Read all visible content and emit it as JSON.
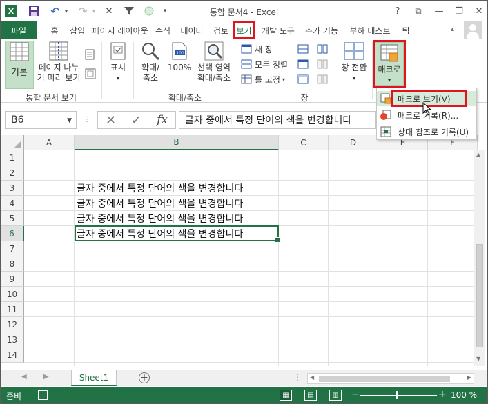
{
  "window": {
    "title": "통합 문서4 - Excel",
    "help": "?",
    "ribbon_opts": "⧉",
    "minimize": "—",
    "restore": "❐",
    "close": "✕"
  },
  "qat": {
    "app_icon": "X",
    "save": "💾",
    "undo": "↶",
    "redo": "↷",
    "more": "✕",
    "filter": "▼"
  },
  "tabs": {
    "file": "파일",
    "items": [
      "홈",
      "삽입",
      "페이지 레이아웃",
      "수식",
      "데이터",
      "검토",
      "보기",
      "개발 도구",
      "추가 기능",
      "부하 테스트",
      "팀"
    ],
    "active": "보기"
  },
  "ribbon": {
    "groups": {
      "workbook_views": "통합 문서 보기",
      "zoom": "확대/축소",
      "window": "창"
    },
    "buttons": {
      "basic": "기본",
      "page_break_l1": "페이지 나누",
      "page_break_l2": "기 미리 보기",
      "show": "표시",
      "zoom_l1": "확대/",
      "zoom_l2": "축소",
      "zoom100": "100%",
      "zoom_sel_l1": "선택 영역",
      "zoom_sel_l2": "확대/축소",
      "new_window": "새 창",
      "arrange_all": "모두 정렬",
      "freeze": "틀 고정",
      "switch_l1": "창 전환",
      "macro": "매크로",
      "caret": "▾"
    }
  },
  "formula_bar": {
    "name_box": "B6",
    "cancel": "✕",
    "enter": "✓",
    "fx": "fx",
    "value": "글자 중에서 특정 단어의 색을 변경합니다"
  },
  "grid": {
    "columns": [
      "A",
      "B",
      "C",
      "D",
      "E",
      "F"
    ],
    "selected_column": "B",
    "rows": [
      "1",
      "2",
      "3",
      "4",
      "5",
      "6",
      "7",
      "8",
      "9",
      "10",
      "11",
      "12",
      "13",
      "14"
    ],
    "selected_row": "6",
    "cells": {
      "B3": "글자 중에서 특정 단어의 색을 변경합니다",
      "B4": "글자 중에서 특정 단어의 색을 변경합니다",
      "B5": "글자 중에서 특정 단어의 색을 변경합니다",
      "B6": "글자 중에서 특정 단어의 색을 변경합니다"
    }
  },
  "sheets": {
    "tabs": [
      "Sheet1"
    ],
    "add": "+",
    "dots": "⋮"
  },
  "dropdown": {
    "view_macros": "매크로 보기(V)",
    "record_macro": "매크로 기록(R)...",
    "relative_ref": "상대 참조로 기록(U)"
  },
  "status": {
    "ready": "준비",
    "zoom": "100 %",
    "minus": "−",
    "plus": "+"
  },
  "colors": {
    "accent": "#217346",
    "highlight": "#e0141e"
  }
}
